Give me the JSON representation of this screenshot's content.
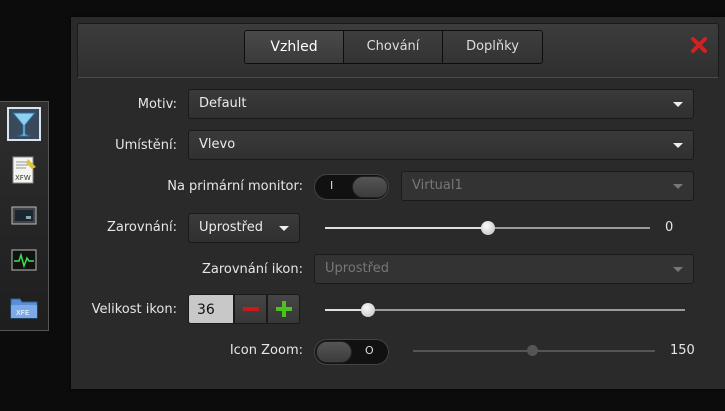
{
  "dock": {
    "items": [
      {
        "icon": "cocktail-glass-icon",
        "active": true
      },
      {
        "icon": "xfw-editor-icon"
      },
      {
        "icon": "monitor-icon"
      },
      {
        "icon": "system-monitor-icon"
      },
      {
        "icon": "xfe-folder-icon"
      }
    ],
    "editor_badge": "XFW",
    "folder_badge": "XFE"
  },
  "tabs": [
    {
      "label": "Vzhled",
      "active": true
    },
    {
      "label": "Chování"
    },
    {
      "label": "Doplňky"
    }
  ],
  "colors": {
    "close": "#d42020",
    "plus": "#4cc21c",
    "minus": "#c81a1a"
  },
  "form": {
    "motiv_label": "Motiv:",
    "motiv_value": "Default",
    "umisteni_label": "Umístění:",
    "umisteni_value": "Vlevo",
    "monitor_label": "Na primární monitor:",
    "monitor_switch_glyph": "I",
    "monitor_value": "Virtual1",
    "zarovnani_label": "Zarovnání:",
    "zarovnani_value": "Uprostřed",
    "zarovnani_slider_value": "0",
    "zarovnani_slider_fraction": 0.5,
    "zarovnani_ikon_label": "Zarovnání ikon:",
    "zarovnani_ikon_value": "Uprostřed",
    "velikost_label": "Velikost ikon:",
    "velikost_value": "36",
    "velikost_slider_fraction": 0.12,
    "zoom_label": "Icon Zoom:",
    "zoom_switch_glyph": "O",
    "zoom_value": "150",
    "zoom_slider_fraction": 0.5
  }
}
